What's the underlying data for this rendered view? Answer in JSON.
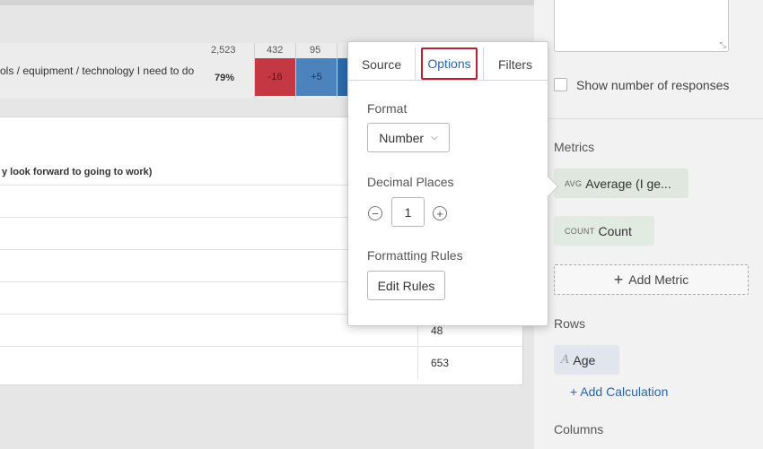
{
  "heatmap": {
    "row_label": "ols / equipment / technology I need to do",
    "percent": "79%",
    "counts": [
      "2,523",
      "432",
      "95"
    ],
    "cells": [
      {
        "value": "-16",
        "color": "#c33842"
      },
      {
        "value": "+5",
        "color": "#4c83bd"
      },
      {
        "value": "",
        "color": "#2c6aa9"
      }
    ]
  },
  "table": {
    "header": "y look forward to going to work)",
    "row_values": [
      "",
      "",
      "",
      "",
      "48",
      "653"
    ]
  },
  "popover": {
    "tabs": [
      {
        "label": "Source"
      },
      {
        "label": "Options",
        "active": true
      },
      {
        "label": "Filters"
      }
    ],
    "format_label": "Format",
    "format_value": "Number",
    "decimal_label": "Decimal Places",
    "decimal_value": "1",
    "formatting_rules_label": "Formatting Rules",
    "edit_rules_button": "Edit Rules"
  },
  "right_panel": {
    "show_responses_label": "Show number of responses",
    "show_responses_checked": false,
    "metrics_label": "Metrics",
    "metrics": [
      {
        "tag": "AVG",
        "text": "Average (I ge...",
        "color": "#dfe7df"
      },
      {
        "tag": "COUNT",
        "text": "Count",
        "color": "#e2ebe2"
      }
    ],
    "add_metric_label": "Add Metric",
    "rows_label": "Rows",
    "row_item": "Age",
    "add_calculation_label": "+ Add Calculation",
    "columns_label": "Columns"
  },
  "colors": {
    "accent_blue": "#2466b6",
    "active_tab_border": "#b81f33"
  },
  "icons": {
    "chevron": "chevron-down-icon",
    "minus": "minus-circle-icon",
    "plus": "plus-circle-icon",
    "text_type": "text-type-icon"
  }
}
